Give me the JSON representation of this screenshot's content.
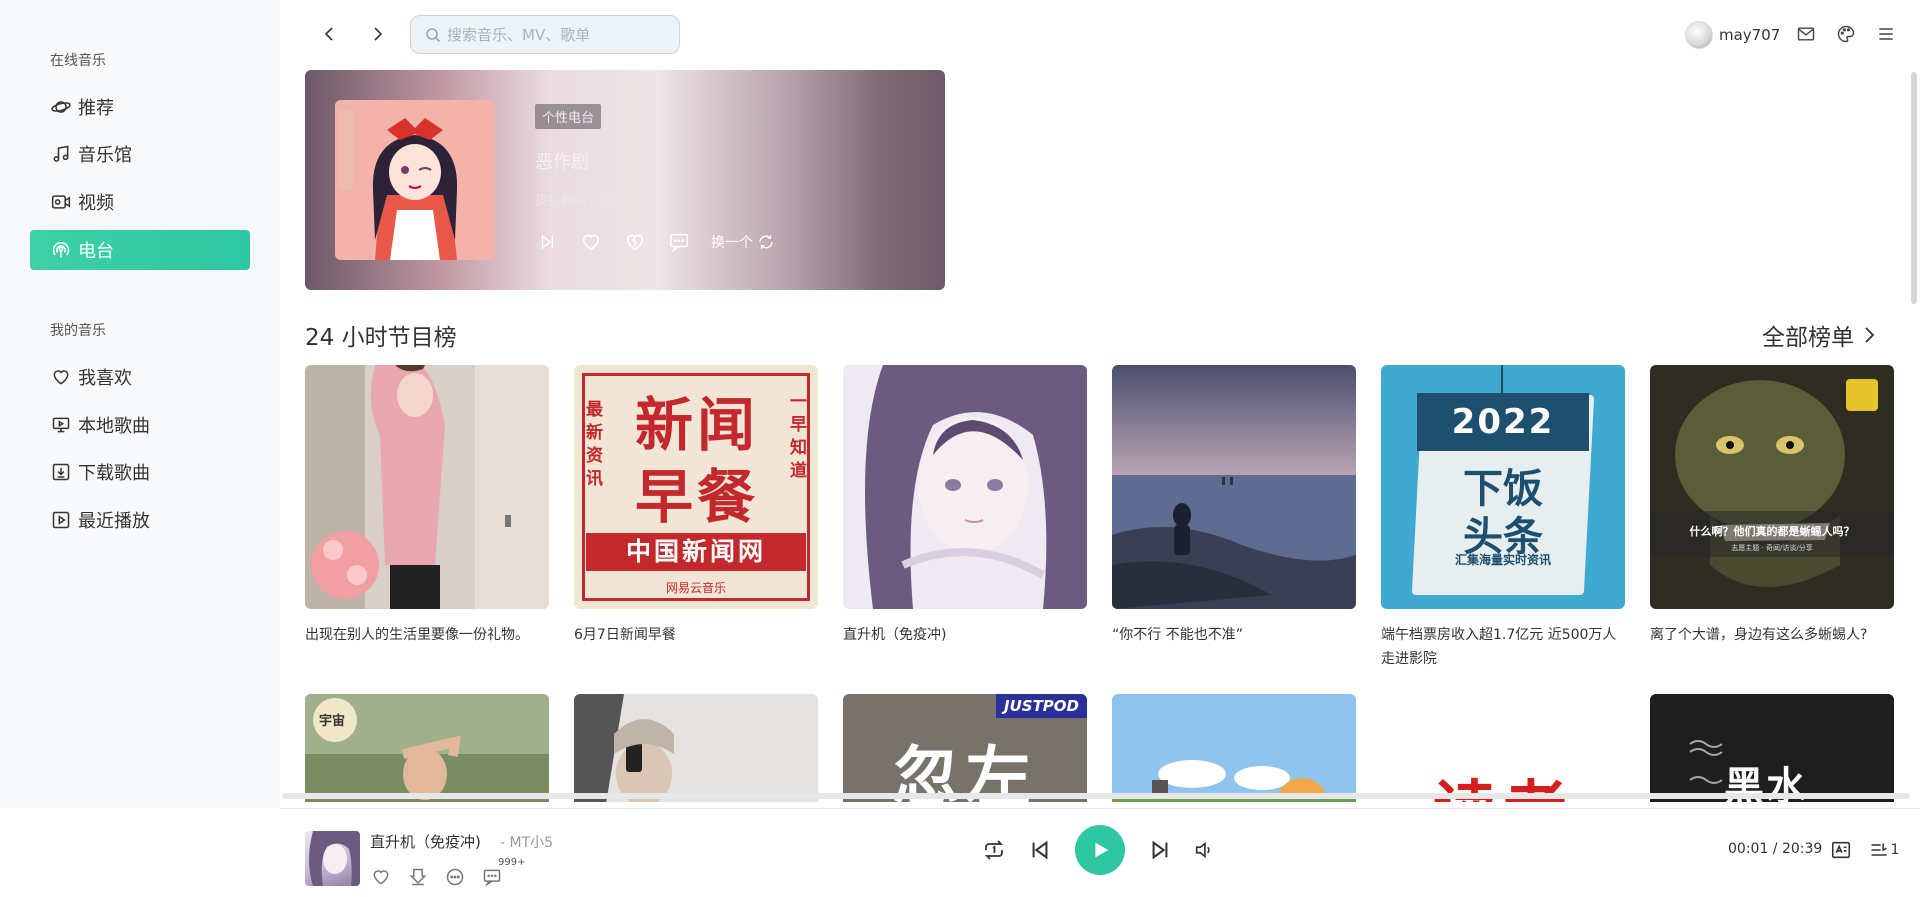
{
  "sidebar": {
    "section_online": "在线音乐",
    "section_mine": "我的音乐",
    "items_online": [
      {
        "label": "推荐",
        "icon": "planet-icon"
      },
      {
        "label": "音乐馆",
        "icon": "music-note-icon"
      },
      {
        "label": "视频",
        "icon": "video-icon"
      },
      {
        "label": "电台",
        "icon": "radio-icon",
        "active": true
      }
    ],
    "items_mine": [
      {
        "label": "我喜欢",
        "icon": "heart-icon"
      },
      {
        "label": "本地歌曲",
        "icon": "monitor-icon"
      },
      {
        "label": "下载歌曲",
        "icon": "download-icon"
      },
      {
        "label": "最近播放",
        "icon": "play-box-icon"
      }
    ]
  },
  "topbar": {
    "search_placeholder": "搜索音乐、MV、歌单",
    "username": "may707"
  },
  "banner": {
    "tag": "个性电台",
    "title": "恶作剧",
    "subtitle": "贝拉翻唱合集",
    "refresh_label": "换一个"
  },
  "section": {
    "title": "24 小时节目榜",
    "more_label": "全部榜单"
  },
  "cards_row1": [
    {
      "title": "出现在别人的生活里要像一份礼物。"
    },
    {
      "title": "6月7日新闻早餐",
      "cover_text": {
        "top_left": "最新资讯",
        "big": "新闻早餐",
        "right": "一早知道",
        "band": "中国新闻网",
        "brand": "网易云音乐"
      }
    },
    {
      "title": "直升机（免疫冲)"
    },
    {
      "title": "“你不行 不能也不准”"
    },
    {
      "title": "端午档票房收入超1.7亿元 近500万人走进影院",
      "cover_text": {
        "year": "2022",
        "main": "下饭头条",
        "sub": "汇集海量实时资讯"
      }
    },
    {
      "title": "离了个大谱，身边有这么多蜥蜴人?",
      "cover_text": {
        "caption": "什么啊？他们真的都是蜥蜴人吗？",
        "small": "志愿主题 · 奇闻/访谈/分享"
      }
    }
  ],
  "cards_row2": [
    {
      "cover_text": {
        "badge": "宇宙"
      }
    },
    {},
    {
      "cover_text": {
        "brand": "JUSTPOD",
        "big": "忽左"
      }
    },
    {},
    {
      "cover_text": {
        "big": "读者"
      }
    },
    {
      "cover_text": {
        "big": "黑水"
      }
    }
  ],
  "player": {
    "title": "直升机（免疫冲)",
    "artist": "- MT小5",
    "comment_badge": "999+",
    "time": "00:01 / 20:39",
    "queue_count": "1"
  }
}
